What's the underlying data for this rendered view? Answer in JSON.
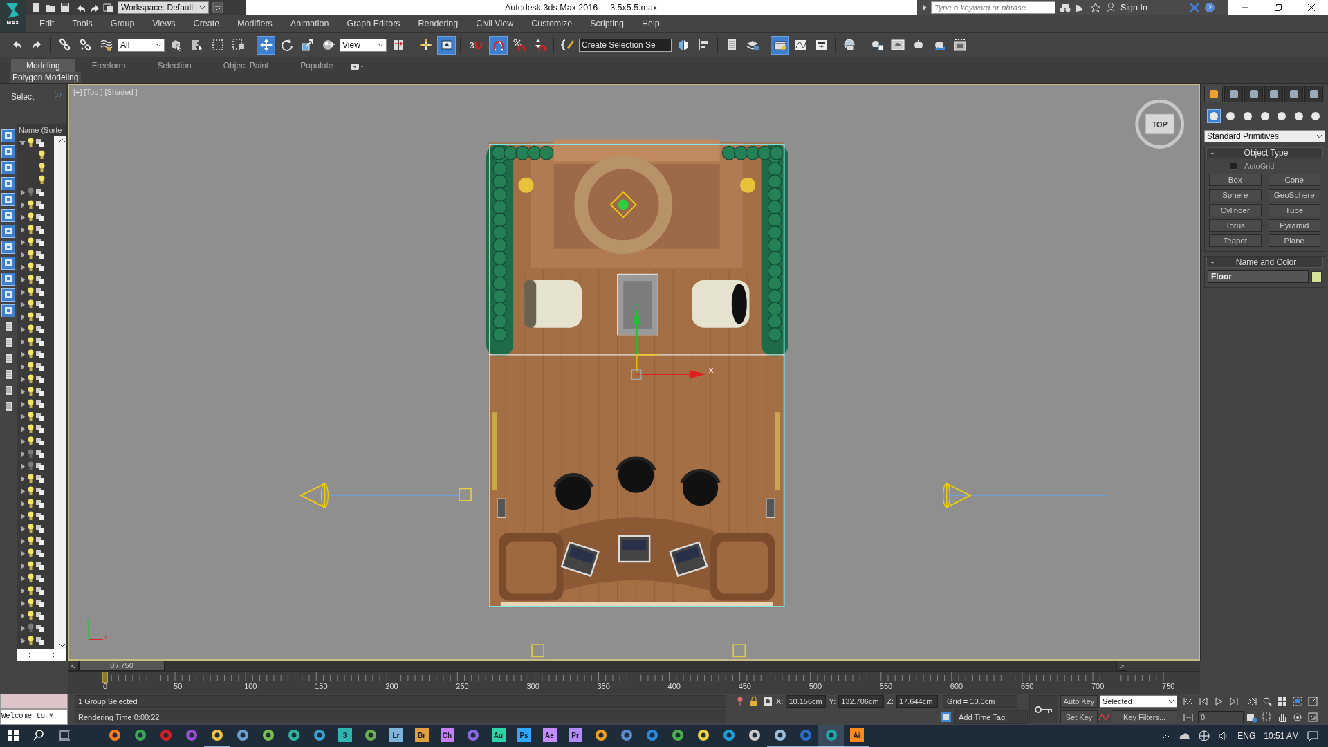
{
  "app": {
    "logo": "MAX",
    "workspace": "Workspace: Default",
    "title": "Autodesk 3ds Max 2016",
    "file_name": "3.5x5.5.max",
    "search": {
      "placeholder": "Type a keyword or phrase"
    },
    "sign_in": "Sign In"
  },
  "menu": [
    "Edit",
    "Tools",
    "Group",
    "Views",
    "Create",
    "Modifiers",
    "Animation",
    "Graph Editors",
    "Rendering",
    "Civil View",
    "Customize",
    "Scripting",
    "Help"
  ],
  "toolbar": {
    "selection_filter": "All",
    "reference_coordinates": "View",
    "snap_toggle": "3",
    "named_selection": "Create Selection Se",
    "buttons": [
      {
        "selected": false
      },
      {
        "selected": false
      },
      {
        "selected": false
      },
      {
        "selected": false
      },
      {
        "selected": false
      },
      {
        "selected": false
      },
      {
        "selected": false
      },
      {
        "selected": false
      },
      {
        "selected": false
      },
      {
        "selected": true
      },
      {
        "selected": false
      },
      {
        "selected": false
      },
      {
        "selected": false
      },
      {
        "selected": false
      },
      {
        "selected": false
      },
      {
        "selected": true
      },
      {
        "selected": false
      },
      {
        "selected": true
      },
      {
        "selected": false
      },
      {
        "selected": false
      },
      {
        "selected": false
      },
      {
        "selected": false
      },
      {
        "selected": false
      },
      {
        "selected": false
      },
      {
        "selected": false
      },
      {
        "selected": true
      },
      {
        "selected": false
      },
      {
        "selected": false
      },
      {
        "selected": false
      },
      {
        "selected": false
      },
      {
        "selected": false
      },
      {
        "selected": false
      },
      {
        "selected": false
      },
      {
        "selected": false
      }
    ]
  },
  "ribbon": {
    "tabs": [
      {
        "label": "Modeling",
        "selected": true
      },
      {
        "label": "Freeform",
        "selected": false
      },
      {
        "label": "Selection",
        "selected": false
      },
      {
        "label": "Object Paint",
        "selected": false
      },
      {
        "label": "Populate",
        "selected": false
      }
    ],
    "panel": "Polygon Modeling"
  },
  "left_panel": {
    "title": "Select",
    "scene_explorer": {
      "header": "Name (Sorte",
      "rows": [
        {
          "expanded": true,
          "visible": true,
          "children": [
            {
              "visible": true
            },
            {
              "visible": true
            },
            {
              "visible": true
            }
          ]
        },
        {
          "expanded": false,
          "visible": false
        },
        {
          "expanded": false,
          "visible": true
        },
        {
          "expanded": false,
          "visible": true
        },
        {
          "expanded": false,
          "visible": true
        },
        {
          "expanded": false,
          "visible": true
        },
        {
          "expanded": false,
          "visible": true
        },
        {
          "expanded": false,
          "visible": true
        },
        {
          "expanded": false,
          "visible": true
        },
        {
          "expanded": false,
          "visible": true
        },
        {
          "expanded": false,
          "visible": true
        },
        {
          "expanded": false,
          "visible": true
        },
        {
          "expanded": false,
          "visible": true
        },
        {
          "expanded": false,
          "visible": true
        },
        {
          "expanded": false,
          "visible": true
        },
        {
          "expanded": false,
          "visible": true
        },
        {
          "expanded": false,
          "visible": true
        },
        {
          "expanded": false,
          "visible": true
        },
        {
          "expanded": false,
          "visible": true
        },
        {
          "expanded": false,
          "visible": true
        },
        {
          "expanded": false,
          "visible": true
        },
        {
          "expanded": false,
          "visible": true
        },
        {
          "expanded": false,
          "visible": false
        },
        {
          "expanded": false,
          "visible": false
        },
        {
          "expanded": false,
          "visible": true
        },
        {
          "expanded": false,
          "visible": true
        },
        {
          "expanded": false,
          "visible": true
        },
        {
          "expanded": false,
          "visible": true
        },
        {
          "expanded": false,
          "visible": true
        },
        {
          "expanded": false,
          "visible": true
        },
        {
          "expanded": false,
          "visible": true
        },
        {
          "expanded": false,
          "visible": true
        },
        {
          "expanded": false,
          "visible": true
        },
        {
          "expanded": false,
          "visible": true
        },
        {
          "expanded": false,
          "visible": true
        },
        {
          "expanded": false,
          "visible": true
        },
        {
          "expanded": false,
          "visible": false
        },
        {
          "expanded": false,
          "visible": true
        }
      ]
    }
  },
  "viewport": {
    "label": "[+] [Top ] [Shaded ]",
    "view_cube": "TOP",
    "gizmo_labels": [
      "y",
      "x"
    ],
    "axis_labels": [
      "y",
      "x"
    ]
  },
  "command_panel": {
    "tabs": [
      {
        "selected": true
      },
      {
        "selected": false
      },
      {
        "selected": false
      },
      {
        "selected": false
      },
      {
        "selected": false
      },
      {
        "selected": false
      }
    ],
    "categories": [
      {
        "selected": true
      },
      {
        "selected": false
      },
      {
        "selected": false
      },
      {
        "selected": false
      },
      {
        "selected": false
      },
      {
        "selected": false
      },
      {
        "selected": false
      }
    ],
    "dropdown": "Standard Primitives",
    "object_type": {
      "title": "Object Type",
      "collapse": "-",
      "autogrid": {
        "label": "AutoGrid",
        "checked": false
      },
      "buttons": [
        "Box",
        "Cone",
        "Sphere",
        "GeoSphere",
        "Cylinder",
        "Tube",
        "Torus",
        "Pyramid",
        "Teapot",
        "Plane"
      ]
    },
    "name_and_color": {
      "title": "Name and Color",
      "collapse": "-",
      "name": "Floor",
      "color": "#d6e29c"
    }
  },
  "timeline": {
    "prev": "<",
    "position": "0 / 750",
    "next": ">",
    "ticks": [
      "0",
      "50",
      "100",
      "150",
      "200",
      "250",
      "300",
      "350",
      "400",
      "450",
      "500",
      "550",
      "600",
      "650",
      "700",
      "750"
    ]
  },
  "status": {
    "listener": "Welcome to M",
    "selection": "1 Group Selected",
    "render_time": "Rendering Time  0:00:22",
    "x_label": "X:",
    "x": "10.156cm",
    "y_label": "Y:",
    "y": "132.706cm",
    "z_label": "Z:",
    "z": "17.644cm",
    "grid": "Grid = 10.0cm",
    "add_time_tag": "Add Time Tag",
    "auto_key": "Auto Key",
    "key_mode": "Selected",
    "set_key": "Set Key",
    "key_filters": "Key Filters...",
    "frame": "0"
  },
  "taskbar": {
    "apps": [
      {
        "open": false,
        "selected": false
      },
      {
        "open": false,
        "selected": false
      },
      {
        "open": false,
        "selected": false
      },
      {
        "open": false,
        "selected": false
      },
      {
        "open": true,
        "selected": false
      },
      {
        "open": false,
        "selected": false
      },
      {
        "open": false,
        "selected": false
      },
      {
        "open": false,
        "selected": false
      },
      {
        "open": false,
        "selected": false
      },
      {
        "label": "3",
        "color": "#2fb5b0",
        "open": false,
        "selected": false
      },
      {
        "open": false,
        "selected": false
      },
      {
        "label": "Lr",
        "color": "#7fb4d8",
        "open": false,
        "selected": false
      },
      {
        "label": "Br",
        "color": "#e0a040",
        "open": false,
        "selected": false
      },
      {
        "label": "Ch",
        "color": "#c77dff",
        "open": false,
        "selected": false
      },
      {
        "open": false,
        "selected": false
      },
      {
        "label": "Au",
        "color": "#2ed3a8",
        "open": false,
        "selected": false
      },
      {
        "label": "Ps",
        "color": "#31a8ff",
        "open": false,
        "selected": false
      },
      {
        "label": "Ae",
        "color": "#c58cff",
        "open": false,
        "selected": false
      },
      {
        "label": "Pr",
        "color": "#b58cff",
        "open": false,
        "selected": false
      },
      {
        "open": false,
        "selected": false
      },
      {
        "open": false,
        "selected": false
      },
      {
        "open": false,
        "selected": false
      },
      {
        "open": false,
        "selected": false
      },
      {
        "open": false,
        "selected": false
      },
      {
        "open": false,
        "selected": false
      },
      {
        "open": false,
        "selected": false
      },
      {
        "open": true,
        "selected": false
      },
      {
        "open": true,
        "selected": false
      },
      {
        "open": true,
        "selected": true
      },
      {
        "label": "Ai",
        "color": "#ff8a1c",
        "open": true,
        "selected": false
      }
    ],
    "language": "ENG",
    "time": "10:51 AM"
  }
}
